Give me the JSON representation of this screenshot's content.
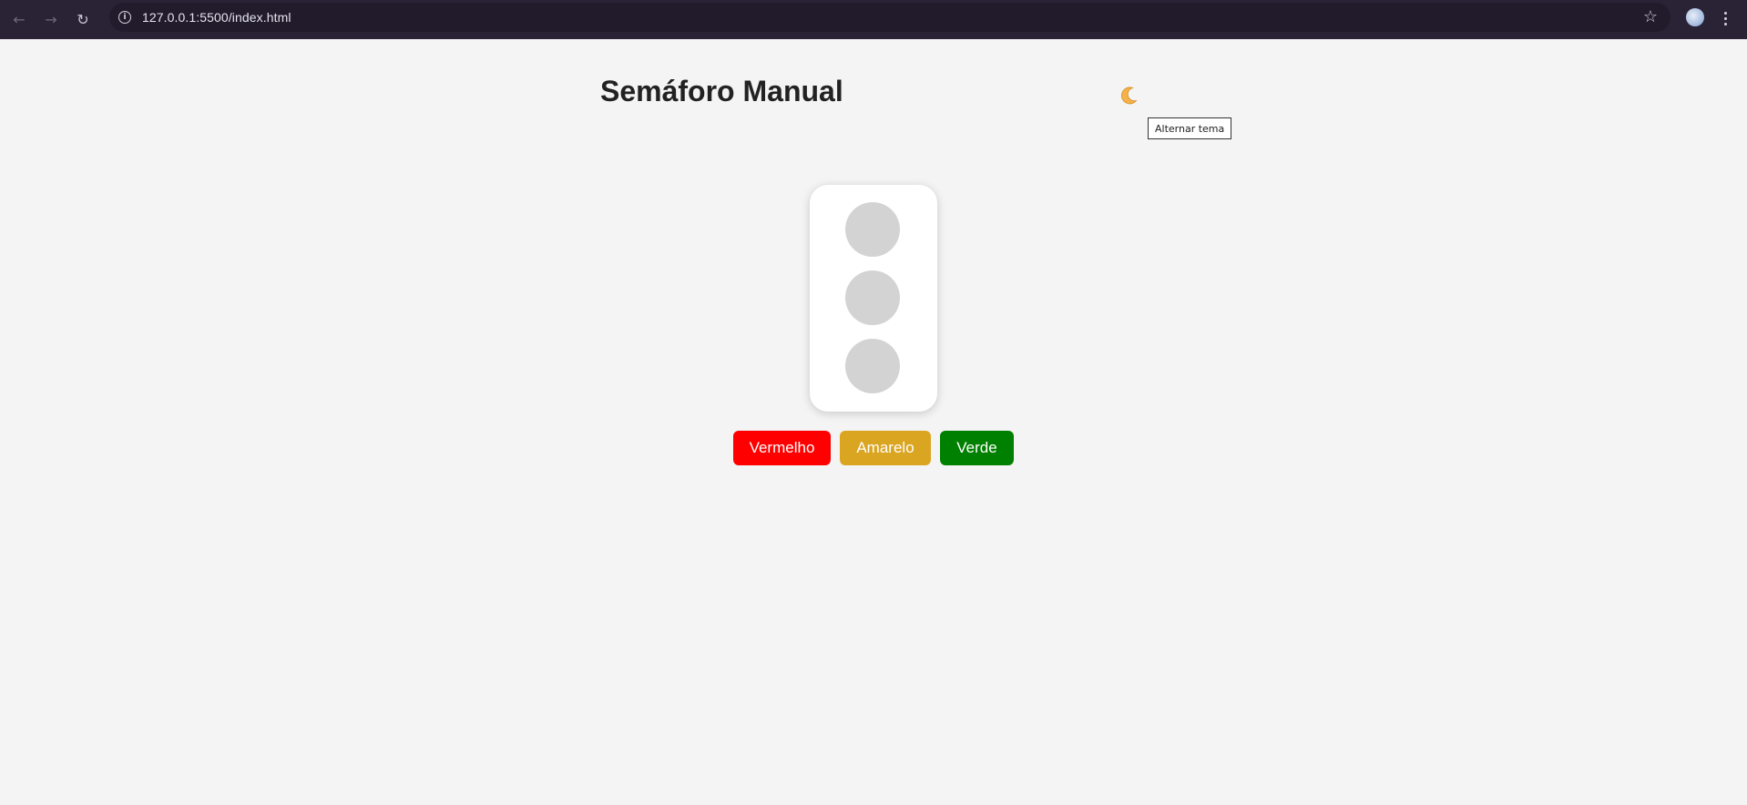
{
  "browser": {
    "url": "127.0.0.1:5500/index.html",
    "back_icon": "arrow-left-icon",
    "forward_icon": "arrow-right-icon",
    "reload_icon": "reload-icon",
    "site_info_icon": "info-icon",
    "bookmark_icon": "star-icon",
    "menu_icon": "kebab-menu-icon"
  },
  "page": {
    "title": "Semáforo Manual",
    "theme_toggle": {
      "icon": "moon-icon",
      "tooltip": "Alternar tema"
    },
    "traffic_light": {
      "housing_color": "#ffffff",
      "lamps": [
        {
          "name": "red",
          "state": "off",
          "color": "#d3d3d3"
        },
        {
          "name": "yellow",
          "state": "off",
          "color": "#d3d3d3"
        },
        {
          "name": "green",
          "state": "off",
          "color": "#d3d3d3"
        }
      ]
    },
    "buttons": [
      {
        "label": "Vermelho",
        "color": "#ff0000"
      },
      {
        "label": "Amarelo",
        "color": "#daa520"
      },
      {
        "label": "Verde",
        "color": "#008000"
      }
    ]
  },
  "colors": {
    "browser_bar": "#2a2336",
    "page_background": "#f4f4f4",
    "title_text": "#222222"
  }
}
